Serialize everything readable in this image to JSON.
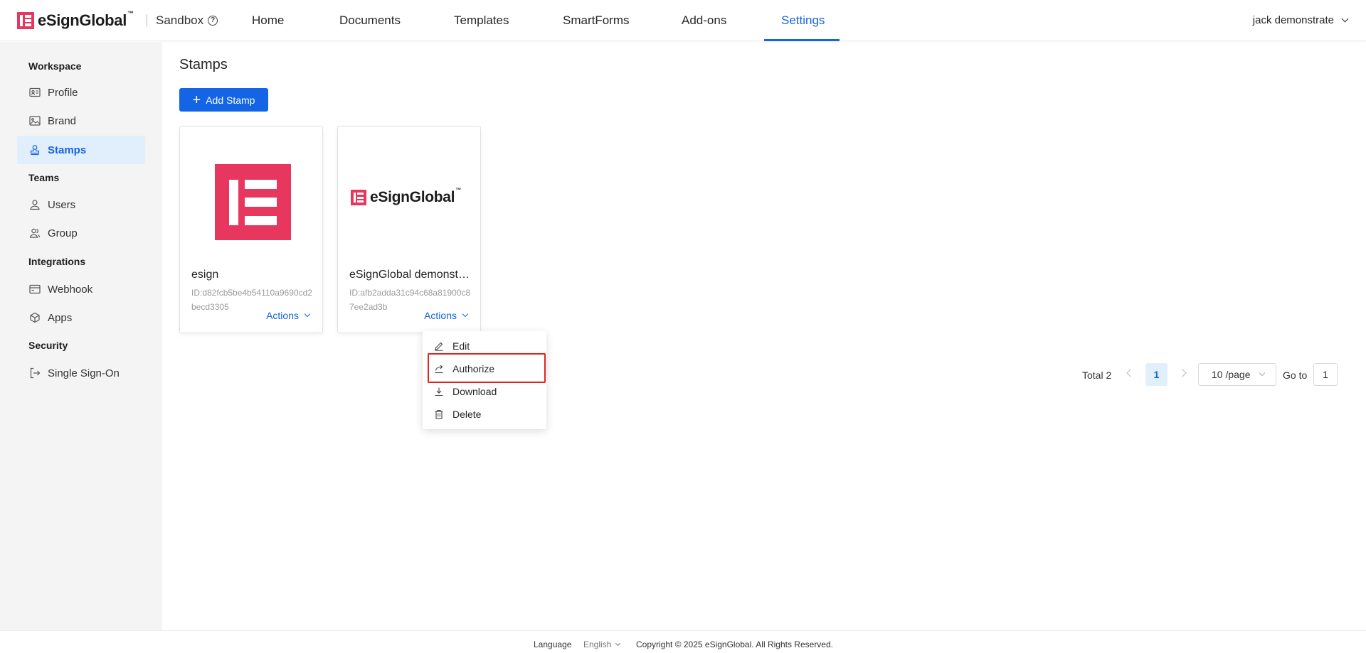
{
  "brand": {
    "name": "eSignGlobal",
    "tm": "™",
    "accent": "#e8375f",
    "primary": "#1464e6"
  },
  "header": {
    "env_label": "Sandbox",
    "nav": [
      {
        "label": "Home"
      },
      {
        "label": "Documents"
      },
      {
        "label": "Templates"
      },
      {
        "label": "SmartForms"
      },
      {
        "label": "Add-ons"
      },
      {
        "label": "Settings",
        "active": true
      }
    ],
    "user_name": "jack demonstrate"
  },
  "sidebar": {
    "sections": [
      {
        "title": "Workspace",
        "items": [
          {
            "label": "Profile",
            "icon": "profile-card-icon"
          },
          {
            "label": "Brand",
            "icon": "image-icon"
          },
          {
            "label": "Stamps",
            "icon": "stamp-icon",
            "active": true
          }
        ]
      },
      {
        "title": "Teams",
        "items": [
          {
            "label": "Users",
            "icon": "user-icon"
          },
          {
            "label": "Group",
            "icon": "group-icon"
          }
        ]
      },
      {
        "title": "Integrations",
        "items": [
          {
            "label": "Webhook",
            "icon": "webhook-icon"
          },
          {
            "label": "Apps",
            "icon": "apps-cube-icon"
          }
        ]
      },
      {
        "title": "Security",
        "items": [
          {
            "label": "Single Sign-On",
            "icon": "sign-in-icon"
          }
        ]
      }
    ]
  },
  "main": {
    "title": "Stamps",
    "add_button": "Add Stamp",
    "cards": [
      {
        "name": "esign",
        "id": "ID:d82fcb5be4b54110a9690cd2becd3305",
        "actions": "Actions"
      },
      {
        "name": "eSignGlobal demonstrate",
        "id": "ID:afb2adda31c94c68a81900c87ee2ad3b",
        "actions": "Actions"
      }
    ],
    "dropdown": [
      {
        "label": "Edit",
        "icon": "edit-pen-icon"
      },
      {
        "label": "Authorize",
        "icon": "share-arrow-icon",
        "highlighted": true
      },
      {
        "label": "Download",
        "icon": "download-icon"
      },
      {
        "label": "Delete",
        "icon": "trash-icon"
      }
    ]
  },
  "pagination": {
    "total": "Total 2",
    "current": "1",
    "page_size": "10 /page",
    "goto_label": "Go to",
    "goto_value": "1"
  },
  "footer": {
    "language_label": "Language",
    "language_value": "English",
    "copyright": "Copyright © 2025 eSignGlobal. All Rights Reserved."
  }
}
